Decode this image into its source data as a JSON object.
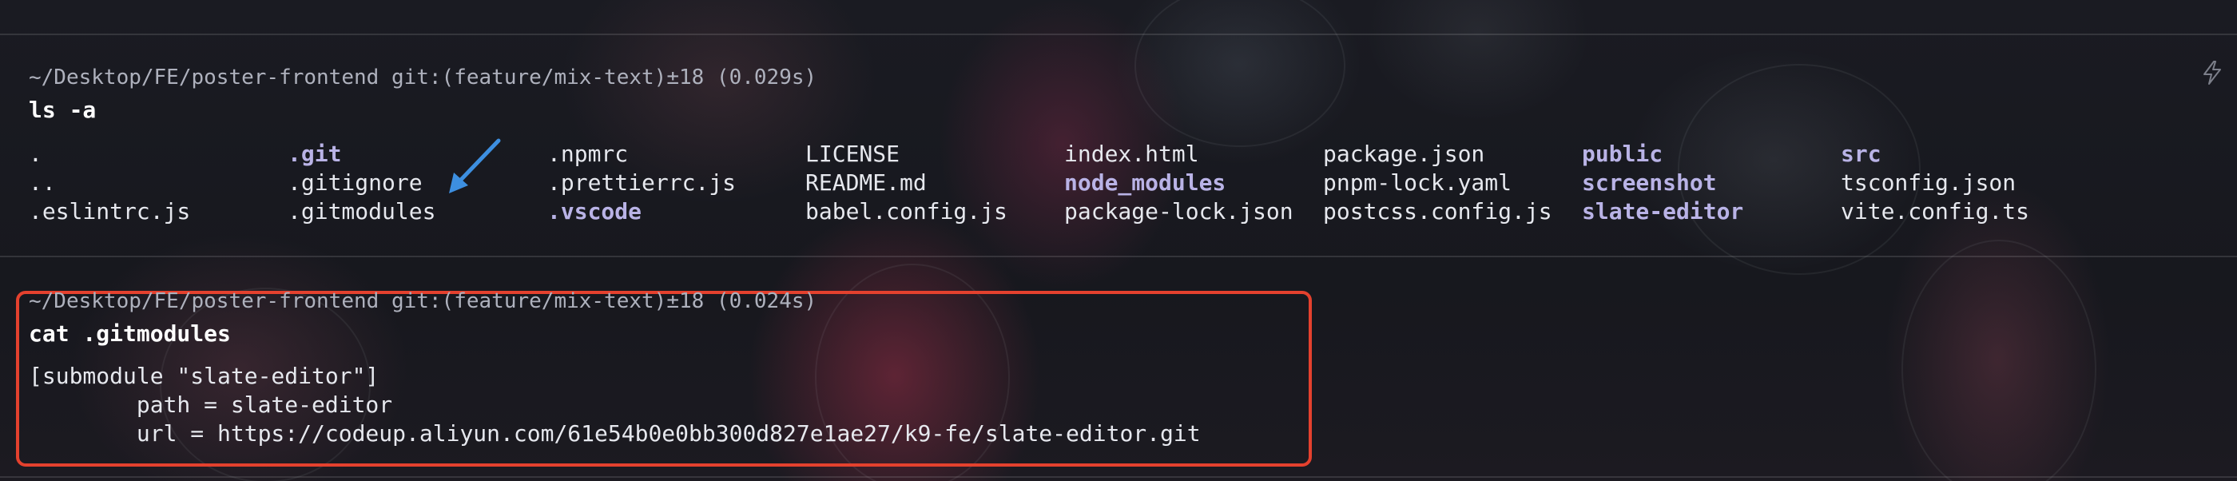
{
  "block1": {
    "prompt": "~/Desktop/FE/poster-frontend git:(feature/mix-text)±18 (0.029s)",
    "command": "ls -a",
    "listing": [
      [
        ".",
        ".git",
        ".npmrc",
        "LICENSE",
        "index.html",
        "package.json",
        "public",
        "src"
      ],
      [
        "..",
        ".gitignore",
        ".prettierrc.js",
        "README.md",
        "node_modules",
        "pnpm-lock.yaml",
        "screenshot",
        "tsconfig.json"
      ],
      [
        ".eslintrc.js",
        ".gitmodules",
        ".vscode",
        "babel.config.js",
        "package-lock.json",
        "postcss.config.js",
        "slate-editor",
        "vite.config.ts"
      ]
    ]
  },
  "block2": {
    "prompt": "~/Desktop/FE/poster-frontend git:(feature/mix-text)±18 (0.024s)",
    "command": "cat .gitmodules",
    "output": [
      "[submodule \"slate-editor\"]",
      "        path = slate-editor",
      "        url = https://codeup.aliyun.com/61e54b0e0bb300d827e1ae27/k9-fe/slate-editor.git"
    ]
  },
  "icons": {
    "arrow": "arrow-annotation-icon",
    "bolt": "bolt-icon"
  },
  "colors": {
    "background": "#17181e",
    "text": "#e6e8ee",
    "directory": "#b9b3e6",
    "highlight_box": "#e4412e",
    "arrow": "#3d8fe0"
  }
}
